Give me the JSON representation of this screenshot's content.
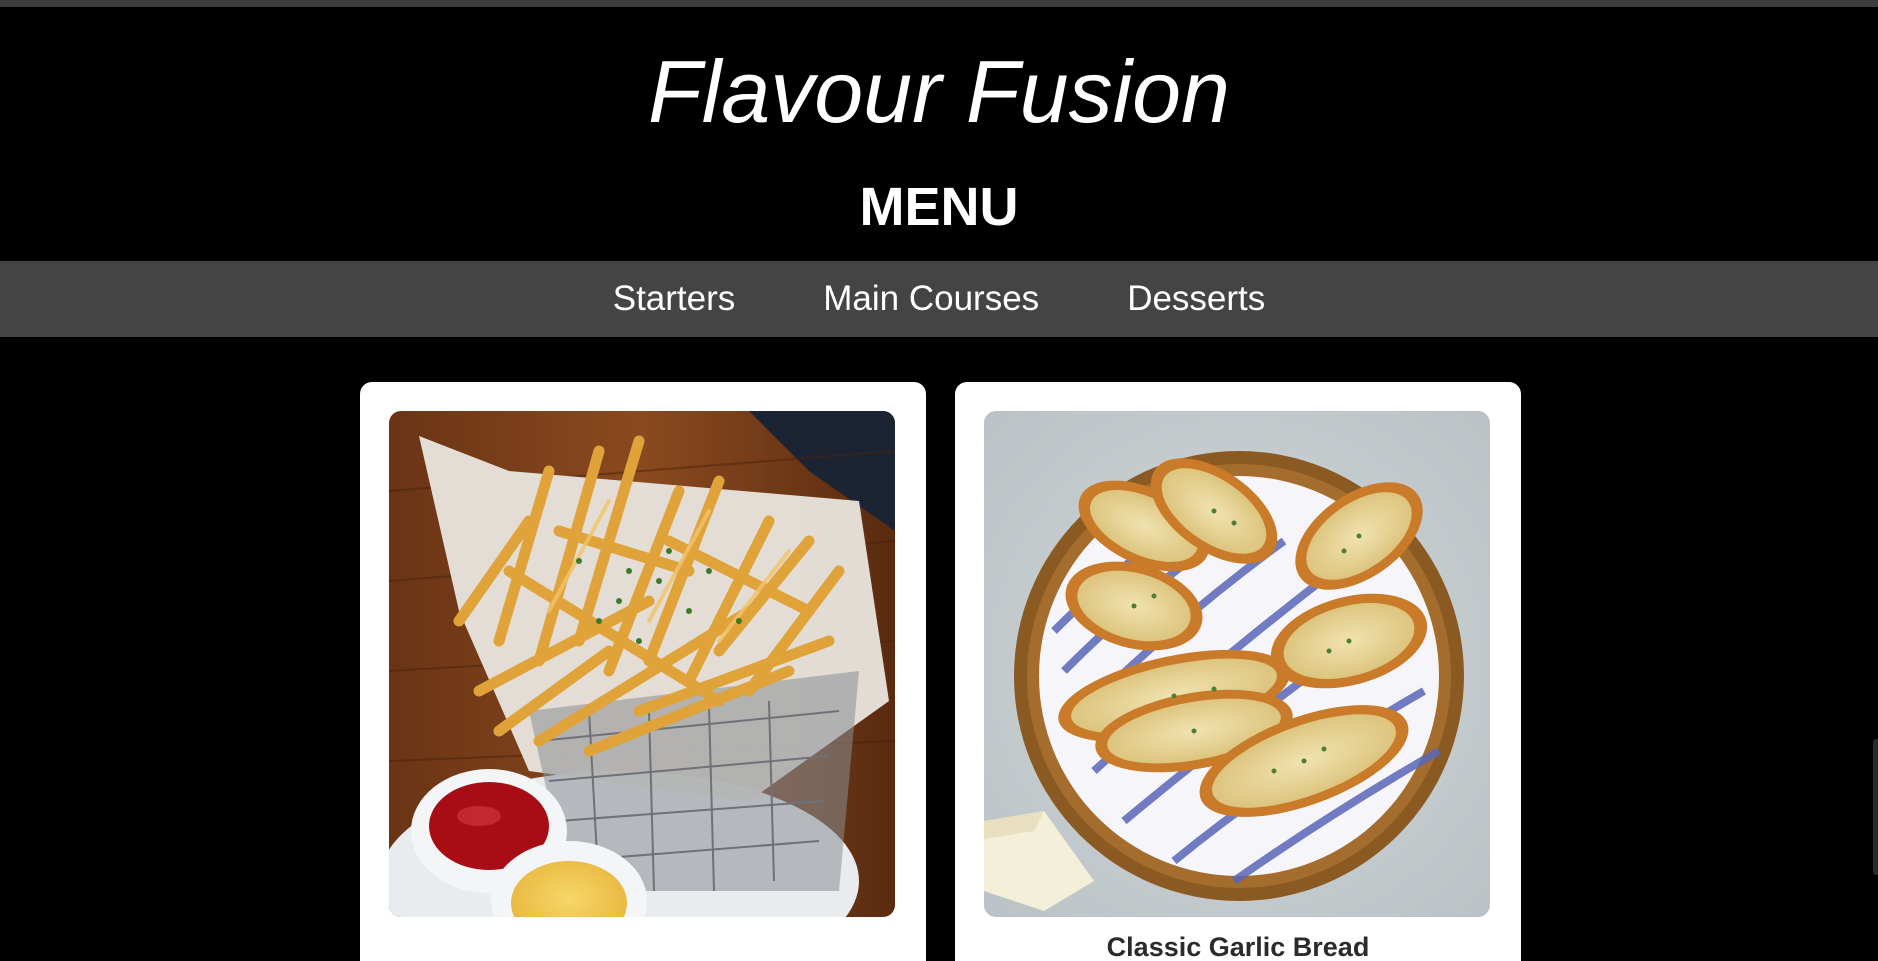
{
  "header": {
    "title": "Flavour Fusion",
    "subtitle": "MENU"
  },
  "nav": {
    "items": [
      {
        "label": "Starters"
      },
      {
        "label": "Main Courses"
      },
      {
        "label": "Desserts"
      }
    ]
  },
  "cards": [
    {
      "title": "",
      "image": "garlic-parmesan-fries-photo"
    },
    {
      "title": "Classic Garlic Bread",
      "image": "garlic-bread-basket-photo"
    }
  ],
  "colors": {
    "background": "#000000",
    "nav_bar": "#444444",
    "card": "#ffffff",
    "text_light": "#ffffff",
    "text_dark": "#2b2b2b"
  }
}
